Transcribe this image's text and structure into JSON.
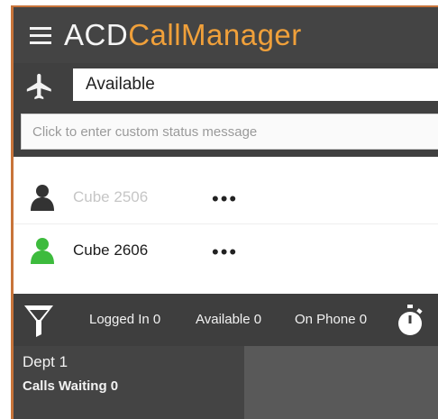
{
  "header": {
    "title_part1": "ACD",
    "title_part2": "CallManager",
    "accent_color": "#f0a03a"
  },
  "status": {
    "selected": "Available",
    "icon": "airplane-icon"
  },
  "custom_status": {
    "placeholder": "Click to enter custom status message"
  },
  "users": [
    {
      "name": "Cube 2506",
      "status_color": "#333333",
      "more": "•••"
    },
    {
      "name": "Cube 2606",
      "status_color": "#3dbb3d",
      "more": "•••"
    }
  ],
  "stats": {
    "logged_in": "Logged In 0",
    "available": "Available 0",
    "on_phone": "On Phone 0"
  },
  "departments": [
    {
      "name": "Dept 1",
      "calls_waiting": "Calls Waiting 0"
    }
  ]
}
